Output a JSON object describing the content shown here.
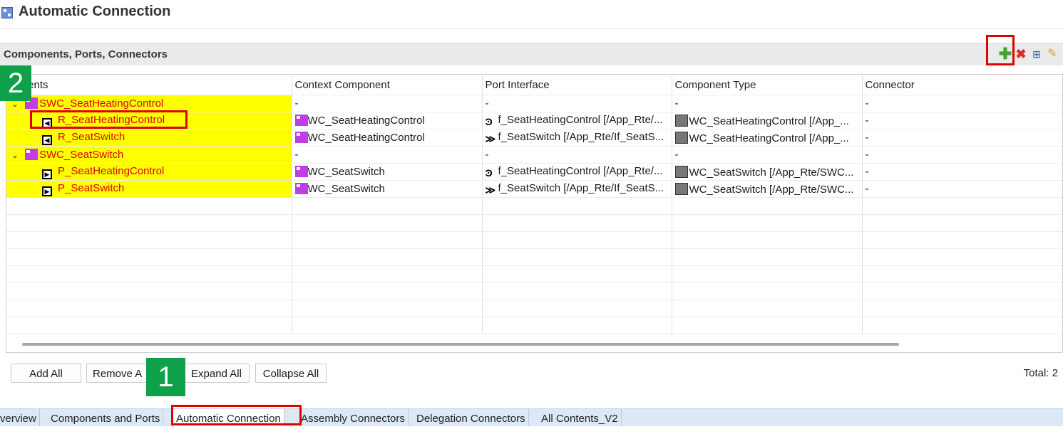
{
  "window": {
    "title": "Automatic Connection"
  },
  "section": {
    "title": "Components, Ports, Connectors"
  },
  "toolbar": {
    "add_icon": "plus-icon",
    "delete_icon": "delete-x-icon",
    "expand_icon": "expand-all-icon",
    "edit_icon": "edit-pencil-icon",
    "add_glyph": "✚",
    "delete_glyph": "✖",
    "expand_glyph": "⊞",
    "edit_glyph": "✎"
  },
  "table": {
    "headers": [
      "Contents",
      "Context Component",
      "Port Interface",
      "Component Type",
      "Connector"
    ],
    "header_visible": "tents",
    "rows": [
      {
        "kind": "component",
        "name": "SWC_SeatHeatingControl",
        "context": "-",
        "port_interface": "-",
        "component_type": "-",
        "connector": "-"
      },
      {
        "kind": "r-port",
        "name": "R_SeatHeatingControl",
        "context": "SWC_SeatHeatingControl",
        "port_interface": "If_SeatHeatingControl [/App_Rte/...",
        "component_type": "SWC_SeatHeatingControl [/App_...",
        "connector": "-"
      },
      {
        "kind": "r-port",
        "name": "R_SeatSwitch",
        "context": "SWC_SeatHeatingControl",
        "port_interface": "If_SeatSwitch [/App_Rte/If_SeatS...",
        "component_type": "SWC_SeatHeatingControl [/App_...",
        "connector": "-"
      },
      {
        "kind": "component",
        "name": "SWC_SeatSwitch",
        "context": "-",
        "port_interface": "-",
        "component_type": "-",
        "connector": "-"
      },
      {
        "kind": "p-port",
        "name": "P_SeatHeatingControl",
        "context": "SWC_SeatSwitch",
        "port_interface": "If_SeatHeatingControl [/App_Rte/...",
        "component_type": "SWC_SeatSwitch [/App_Rte/SWC...",
        "connector": "-"
      },
      {
        "kind": "p-port",
        "name": "P_SeatSwitch",
        "context": "SWC_SeatSwitch",
        "port_interface": "If_SeatSwitch [/App_Rte/If_SeatS...",
        "component_type": "SWC_SeatSwitch [/App_Rte/SWC...",
        "connector": "-"
      }
    ],
    "display": {
      "port_interface": [
        "-",
        "f_SeatHeatingControl [/App_Rte/...",
        "f_SeatSwitch [/App_Rte/If_SeatS...",
        "-",
        "f_SeatHeatingControl [/App_Rte/...",
        "f_SeatSwitch [/App_Rte/If_SeatS..."
      ],
      "component_type": [
        "-",
        "WC_SeatHeatingControl [/App_...",
        "WC_SeatHeatingControl [/App_...",
        "-",
        "WC_SeatSwitch [/App_Rte/SWC...",
        "WC_SeatSwitch [/App_Rte/SWC..."
      ],
      "context": [
        "-",
        "WC_SeatHeatingControl",
        "WC_SeatHeatingControl",
        "-",
        "WC_SeatSwitch",
        "WC_SeatSwitch"
      ]
    }
  },
  "buttons": {
    "add_all": "Add All",
    "remove_all": "Remove All",
    "remove_all_visible": "Remove A",
    "expand_all": "Expand All",
    "collapse_all": "Collapse All"
  },
  "total": "Total: 2",
  "badges": {
    "one": "1",
    "two": "2"
  },
  "tabs": [
    "Overview",
    "Components and Ports",
    "Automatic Connection",
    "Assembly Connectors",
    "Delegation Connectors",
    "All Contents_V2"
  ],
  "tabs_visible_first": "verview",
  "active_tab": "Automatic Connection",
  "colors": {
    "highlight": "#ffff00",
    "annotation_red": "#e00000",
    "badge_green": "#0fa14a"
  }
}
